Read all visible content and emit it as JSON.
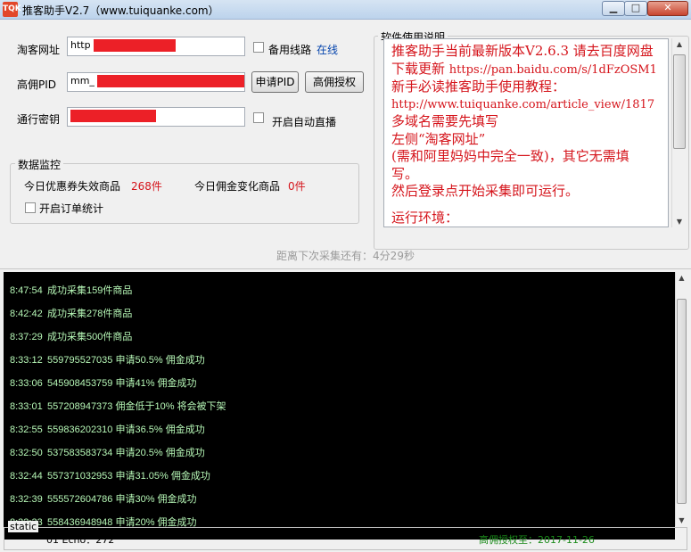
{
  "window": {
    "title": "推客助手V2.7（www.tuiquanke.com）",
    "icon_text": "TQK",
    "min_glyph": "▁",
    "max_glyph": "□",
    "close_glyph": "✕"
  },
  "form": {
    "taobao_label": "淘客网址",
    "taobao_value": "http",
    "backup_line_label": "备用线路",
    "online_label": "在线",
    "pid_label": "高佣PID",
    "pid_value": "mm_",
    "apply_pid_label": "申请PID",
    "high_auth_label": "高佣授权",
    "passkey_label": "通行密钥",
    "auto_live_label": "开启自动直播"
  },
  "monitor": {
    "group_title": "数据监控",
    "expired_label": "今日优惠券失效商品",
    "expired_value": "268件",
    "commission_label": "今日佣金变化商品",
    "commission_value": "0件",
    "order_stats_label": "开启订单统计"
  },
  "help": {
    "group_title": "软件使用说明",
    "lines": [
      "推客助手当前最新版本V2.6.3 请去百度网盘",
      "下载更新",
      "https://pan.baidu.com/s/1dFzOSM1",
      "新手必读推客助手使用教程：",
      "http://www.tuiquanke.com/article_view/1817",
      "多域名需要先填写",
      "左侧“淘客网址”",
      "(需和阿里妈妈中完全一致)，其它无需填",
      "写。",
      "然后登录点开始采集即可运行。",
      "运行环境："
    ]
  },
  "countdown": "距离下次采集还有：4分29秒",
  "log": [
    {
      "time": "8:47:54",
      "msg": "成功采集159件商品"
    },
    {
      "time": "8:42:42",
      "msg": "成功采集278件商品"
    },
    {
      "time": "8:37:29",
      "msg": "成功采集500件商品"
    },
    {
      "time": "8:33:12",
      "msg": "559795527035 申请50.5% 佣金成功"
    },
    {
      "time": "8:33:06",
      "msg": "545908453759 申请41% 佣金成功"
    },
    {
      "time": "8:33:01",
      "msg": "557208947373 佣金低于10% 将会被下架"
    },
    {
      "time": "8:32:55",
      "msg": "559836202310 申请36.5% 佣金成功"
    },
    {
      "time": "8:32:50",
      "msg": "537583583734 申请20.5% 佣金成功"
    },
    {
      "time": "8:32:44",
      "msg": "557371032953 申请31.05% 佣金成功"
    },
    {
      "time": "8:32:39",
      "msg": "555572604786 申请30% 佣金成功"
    },
    {
      "time": "8:32:33",
      "msg": "558436948948 申请20% 佣金成功"
    }
  ],
  "status": {
    "group_title": "static",
    "echo": "01 Echo：272",
    "auth_expiry": "高佣授权至：2017-11-26"
  },
  "colors": {
    "redaction": "#ec2027",
    "count_red": "#d5141b",
    "auth_green": "#1a8a1a",
    "log_text": "#b6f7b6"
  }
}
